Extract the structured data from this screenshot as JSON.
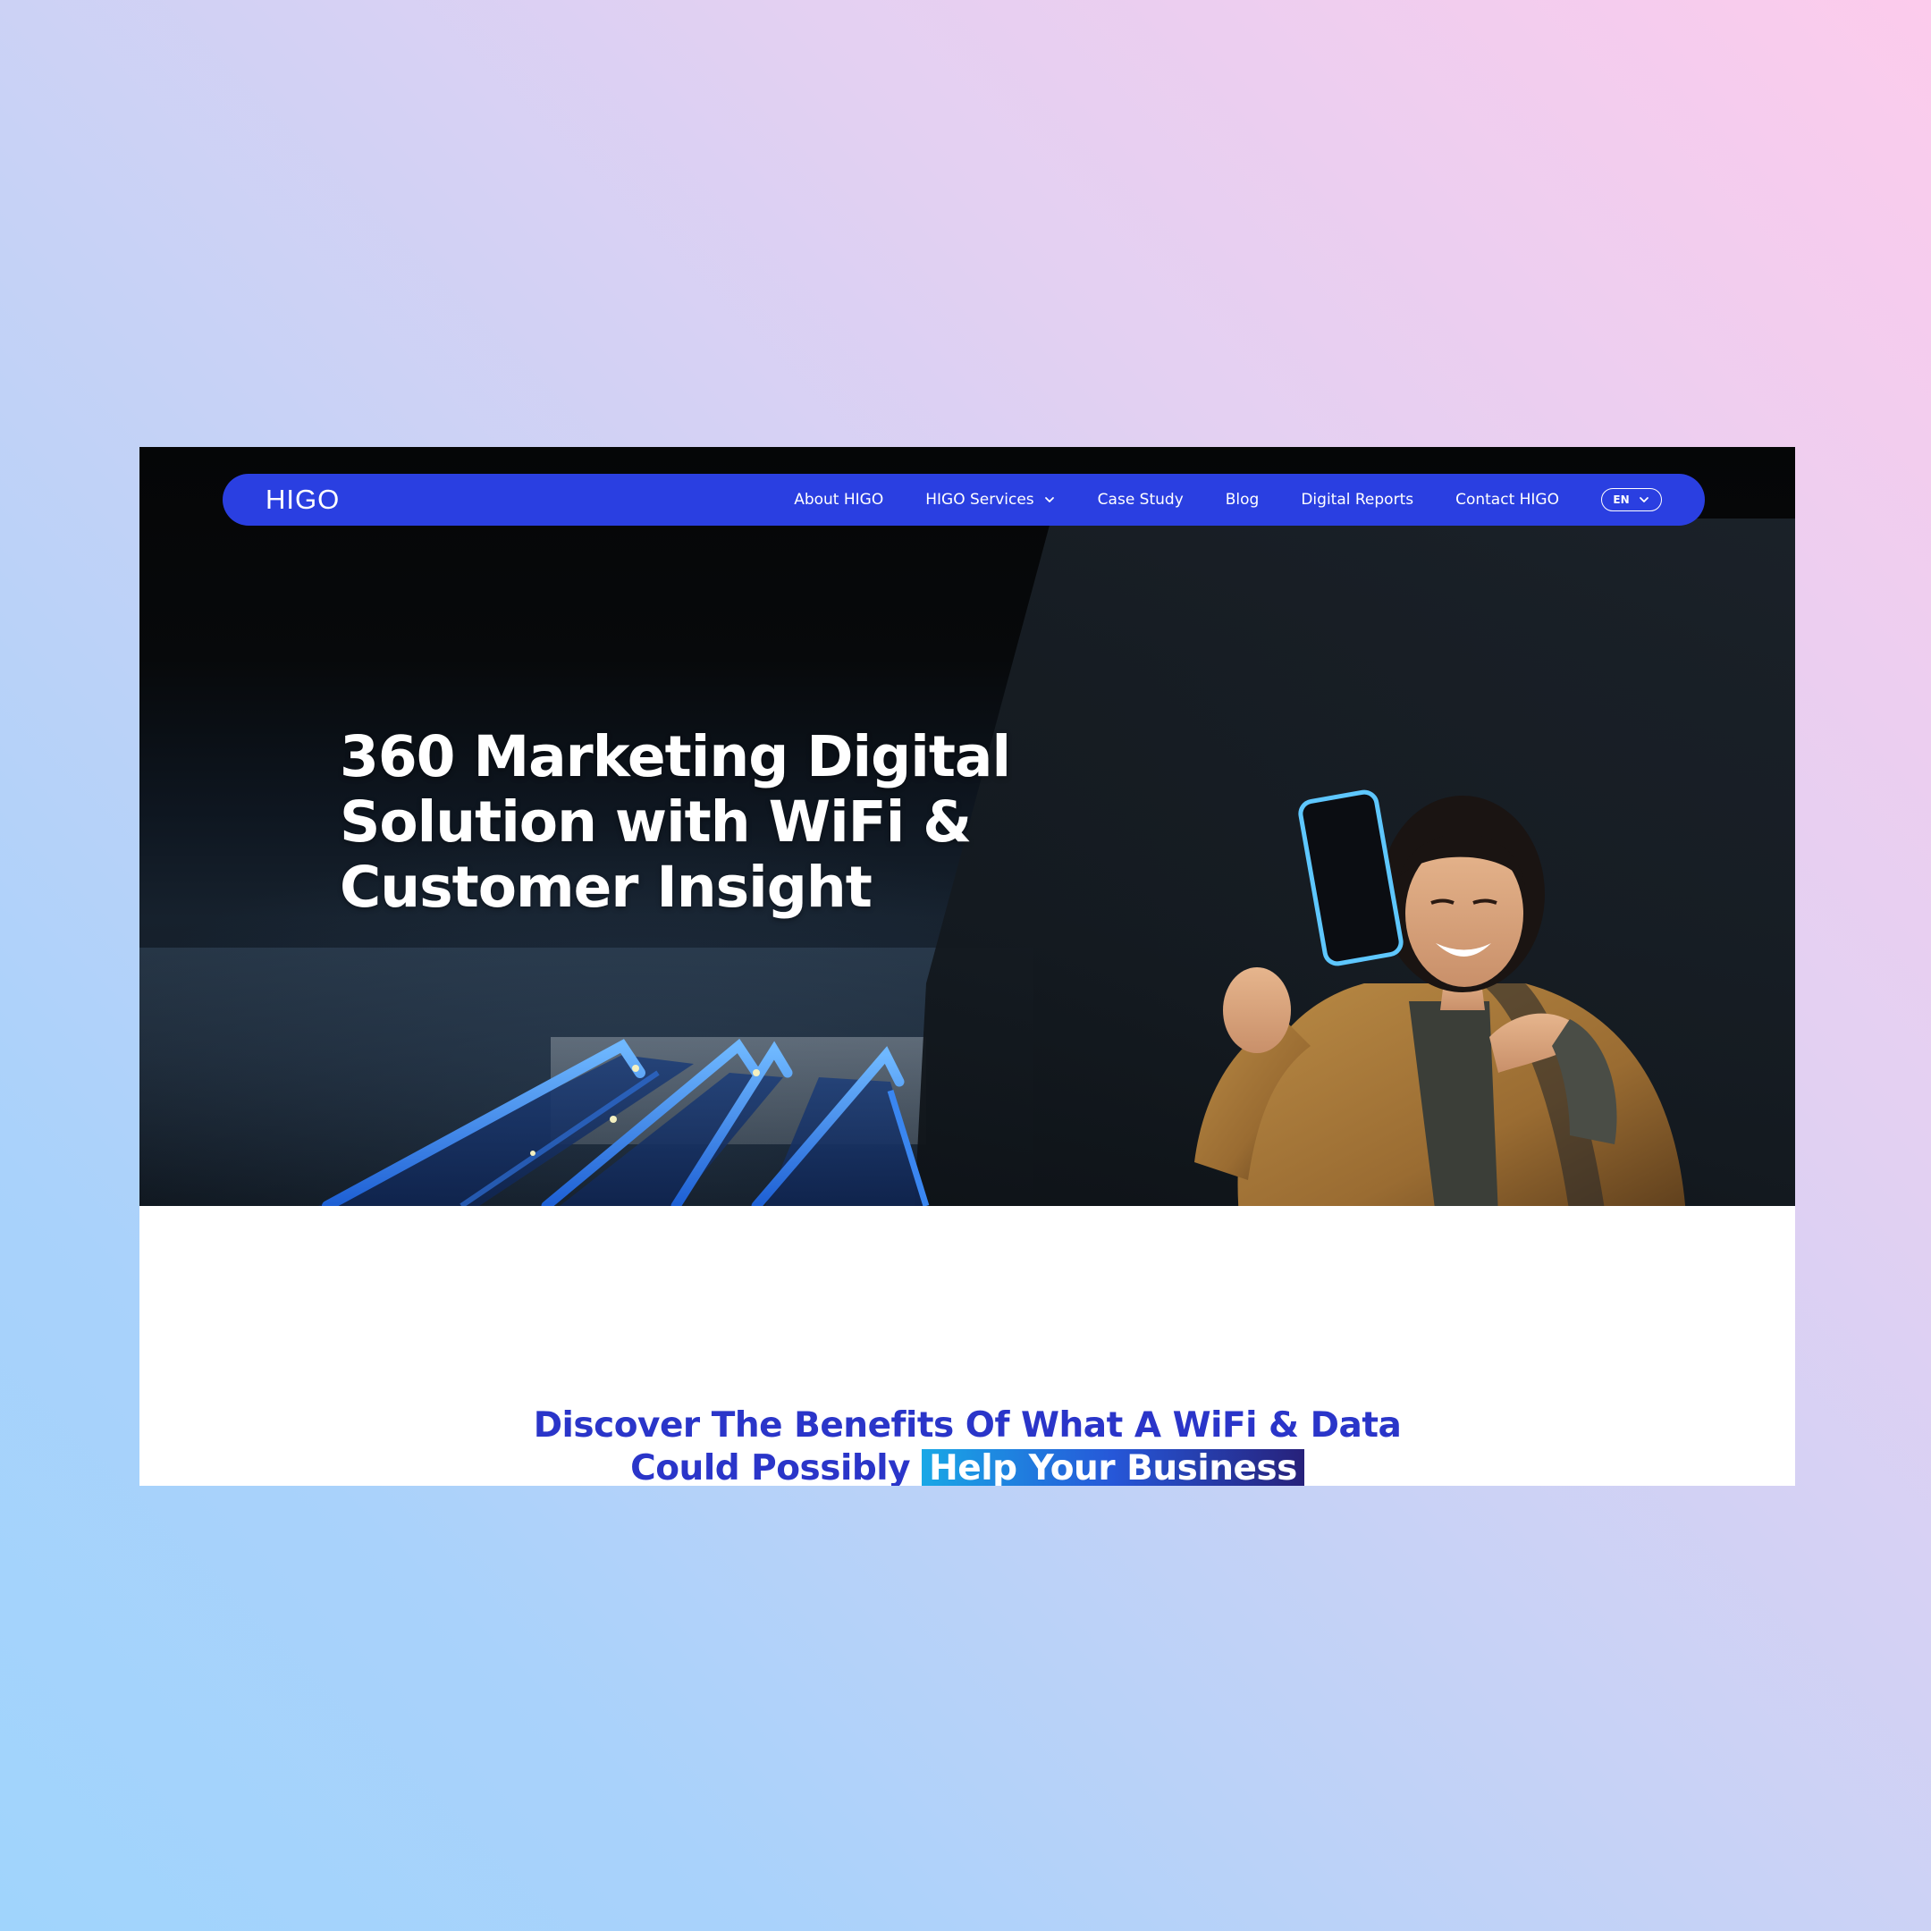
{
  "site": {
    "logo": "HIGO"
  },
  "nav": {
    "items": [
      {
        "label": "About HIGO"
      },
      {
        "label": "HIGO Services",
        "has_dropdown": true
      },
      {
        "label": "Case Study"
      },
      {
        "label": "Blog"
      },
      {
        "label": "Digital Reports"
      },
      {
        "label": "Contact HIGO"
      }
    ],
    "language": "EN"
  },
  "hero": {
    "title_line1": "360 Marketing Digital",
    "title_line2": "Solution with WiFi &",
    "title_line3": "Customer Insight"
  },
  "benefits": {
    "heading_line1": "Discover The Benefits Of What A WiFi & Data",
    "heading_line2_start": "Could Possibly",
    "heading_highlight": "Help Your Business"
  },
  "colors": {
    "nav_bg": "#2a3fe1",
    "heading_blue": "#2a35c9",
    "hero_bg": "#060708",
    "highlight_gradient": [
      "#19a8e6",
      "#2657d8",
      "#27217a"
    ]
  },
  "icons": {
    "dropdown": "chevron-down-icon",
    "language": "chevron-down-icon"
  }
}
